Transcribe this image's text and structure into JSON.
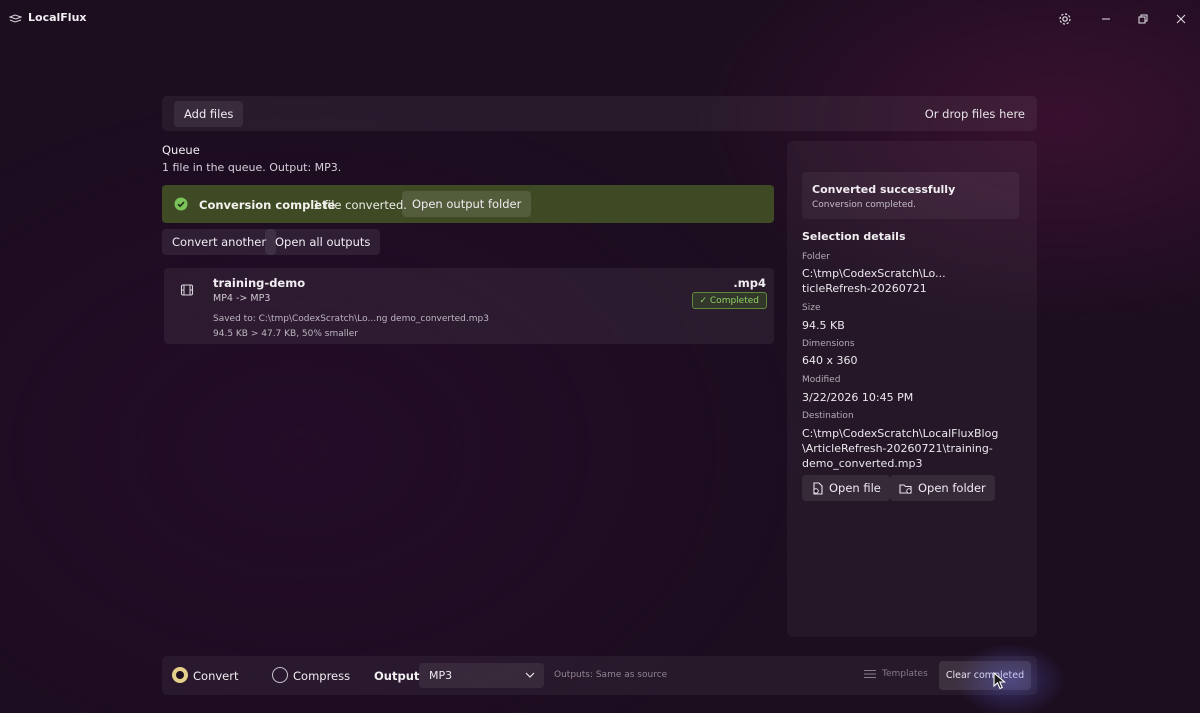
{
  "app": {
    "title": "LocalFlux"
  },
  "titlebar": {
    "icons": [
      "settings-icon",
      "minimize-icon",
      "maximize-icon",
      "close-icon"
    ]
  },
  "dropbar": {
    "add_label": "Add files",
    "hint": "Or drop files here"
  },
  "queue": {
    "title": "Queue",
    "subtitle": "1 file in the queue. Output: MP3."
  },
  "banner": {
    "title": "Conversion complete",
    "message": "1 file converted.",
    "action_label": "Open output folder",
    "color": "#3e4a23"
  },
  "actions": {
    "convert_another": "Convert another",
    "open_all": "Open all outputs"
  },
  "file": {
    "name": "training-demo",
    "ext": ".mp4",
    "format": "MP4 -> MP3",
    "saved": "Saved to:  C:\\tmp\\CodexScratch\\Lo...ng  demo_converted.mp3",
    "size": "94.5 KB  > 47.7 KB, 50% smaller",
    "status": "✓ Completed",
    "status_color": "#8fd165"
  },
  "details": {
    "status_title": "Converted successfully",
    "status_sub": "Conversion completed.",
    "section_title": "Selection details",
    "folder_label": "Folder",
    "folder_line1": "C:\\tmp\\CodexScratch\\Lo...",
    "folder_line2": "ticleRefresh-20260721",
    "size_label": "Size",
    "size_value": "94.5 KB",
    "dimensions_label": "Dimensions",
    "dimensions_value": "640 x 360",
    "modified_label": "Modified",
    "modified_value": "3/22/2026 10:45 PM",
    "destination_label": "Destination",
    "destination_line1": "C:\\tmp\\CodexScratch\\LocalFluxBlog",
    "destination_line2": "\\ArticleRefresh-20260721\\training-",
    "destination_line3": "demo_converted.mp3",
    "open_file_label": "Open file",
    "open_folder_label": "Open folder"
  },
  "bottom": {
    "mode_convert": "Convert",
    "mode_compress": "Compress",
    "selected_mode": "Convert",
    "output_label": "Output",
    "output_value": "MP3",
    "outputs_hint": "Outputs: Same as source",
    "templates_label": "Templates",
    "clear_label": "Clear completed",
    "radio_color": "#e5cf8b"
  }
}
